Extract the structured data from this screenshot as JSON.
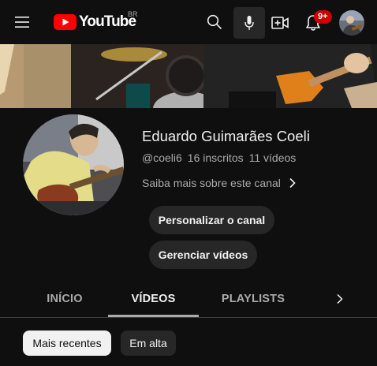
{
  "header": {
    "logo_text": "YouTube",
    "region": "BR",
    "notification_count": "9+",
    "icons": [
      "menu-icon",
      "youtube-logo-icon",
      "search-icon",
      "mic-icon",
      "create-video-icon",
      "bell-icon",
      "avatar"
    ]
  },
  "channel": {
    "name": "Eduardo Guimarães Coeli",
    "handle": "@coeli6",
    "subscribers": "16 inscritos",
    "videos_count": "11 vídeos",
    "about_link": "Saiba mais sobre este canal"
  },
  "actions": {
    "customize": "Personalizar o canal",
    "manage": "Gerenciar vídeos"
  },
  "tabs": [
    {
      "label": "INÍCIO",
      "active": false
    },
    {
      "label": "VÍDEOS",
      "active": true
    },
    {
      "label": "PLAYLISTS",
      "active": false
    }
  ],
  "chips": [
    {
      "label": "Mais recentes",
      "selected": true
    },
    {
      "label": "Em alta",
      "selected": false
    }
  ],
  "colors": {
    "background": "#0f0f0f",
    "brand_red": "#ff0000",
    "badge_red": "#cc0000",
    "button_bg": "#272727",
    "text_primary": "#f1f1f1",
    "text_secondary": "#aaaaaa"
  }
}
